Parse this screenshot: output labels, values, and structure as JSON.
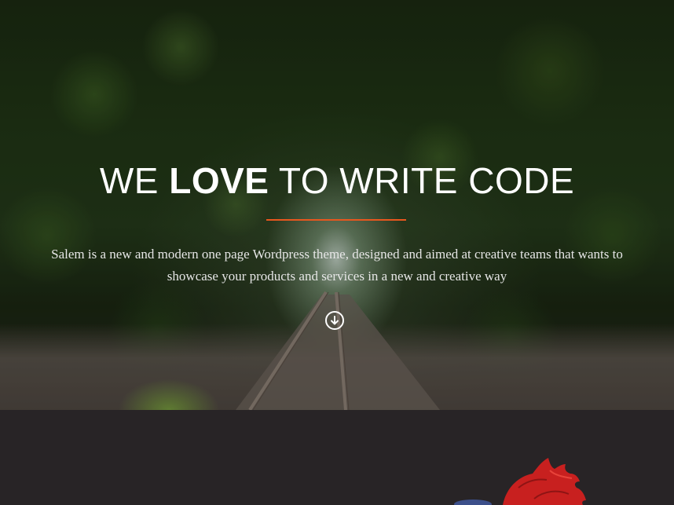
{
  "hero": {
    "headline_pre": "WE ",
    "headline_bold": "LOVE",
    "headline_post": " TO WRITE CODE",
    "tagline_line1": "Salem is a new and modern one page Wordpress theme, designed and aimed at creative teams that wants to",
    "tagline_line2": "showcase your products and services in a new and creative way",
    "scroll_icon": "arrow-down-circle-icon",
    "accent_color": "#e8571e"
  },
  "section_two": {
    "background_color": "#282426",
    "illustration": "red-haired-character-illustration"
  }
}
